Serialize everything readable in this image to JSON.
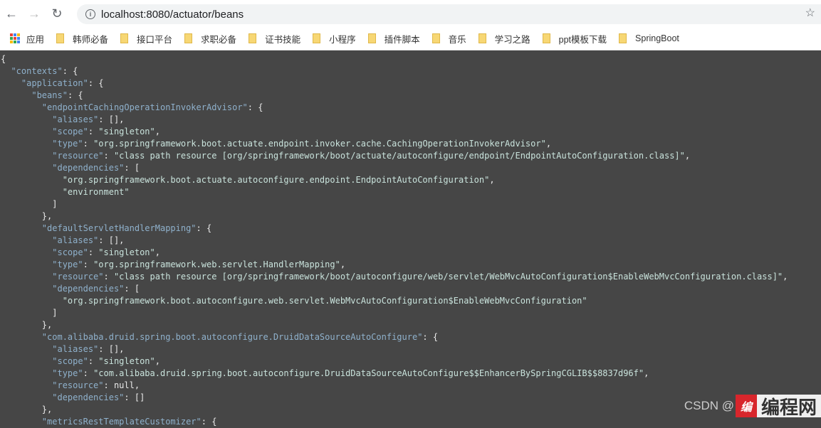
{
  "browser": {
    "url": "localhost:8080/actuator/beans"
  },
  "bookmarks": {
    "apps_label": "应用",
    "items": [
      "韩师必备",
      "接口平台",
      "求职必备",
      "证书技能",
      "小程序",
      "插件脚本",
      "音乐",
      "学习之路",
      "ppt模板下载",
      "SpringBoot"
    ]
  },
  "json_lines": [
    [
      [
        "p",
        "{"
      ]
    ],
    [
      [
        "p",
        "  "
      ],
      [
        "k",
        "\"contexts\""
      ],
      [
        "p",
        ": {"
      ]
    ],
    [
      [
        "p",
        "    "
      ],
      [
        "k",
        "\"application\""
      ],
      [
        "p",
        ": {"
      ]
    ],
    [
      [
        "p",
        "      "
      ],
      [
        "k",
        "\"beans\""
      ],
      [
        "p",
        ": {"
      ]
    ],
    [
      [
        "p",
        "        "
      ],
      [
        "k",
        "\"endpointCachingOperationInvokerAdvisor\""
      ],
      [
        "p",
        ": {"
      ]
    ],
    [
      [
        "p",
        "          "
      ],
      [
        "k",
        "\"aliases\""
      ],
      [
        "p",
        ": [],"
      ]
    ],
    [
      [
        "p",
        "          "
      ],
      [
        "k",
        "\"scope\""
      ],
      [
        "p",
        ": "
      ],
      [
        "s",
        "\"singleton\""
      ],
      [
        "p",
        ","
      ]
    ],
    [
      [
        "p",
        "          "
      ],
      [
        "k",
        "\"type\""
      ],
      [
        "p",
        ": "
      ],
      [
        "s",
        "\"org.springframework.boot.actuate.endpoint.invoker.cache.CachingOperationInvokerAdvisor\""
      ],
      [
        "p",
        ","
      ]
    ],
    [
      [
        "p",
        "          "
      ],
      [
        "k",
        "\"resource\""
      ],
      [
        "p",
        ": "
      ],
      [
        "s",
        "\"class path resource [org/springframework/boot/actuate/autoconfigure/endpoint/EndpointAutoConfiguration.class]\""
      ],
      [
        "p",
        ","
      ]
    ],
    [
      [
        "p",
        "          "
      ],
      [
        "k",
        "\"dependencies\""
      ],
      [
        "p",
        ": ["
      ]
    ],
    [
      [
        "p",
        "            "
      ],
      [
        "s",
        "\"org.springframework.boot.actuate.autoconfigure.endpoint.EndpointAutoConfiguration\""
      ],
      [
        "p",
        ","
      ]
    ],
    [
      [
        "p",
        "            "
      ],
      [
        "s",
        "\"environment\""
      ]
    ],
    [
      [
        "p",
        "          ]"
      ]
    ],
    [
      [
        "p",
        "        },"
      ]
    ],
    [
      [
        "p",
        "        "
      ],
      [
        "k",
        "\"defaultServletHandlerMapping\""
      ],
      [
        "p",
        ": {"
      ]
    ],
    [
      [
        "p",
        "          "
      ],
      [
        "k",
        "\"aliases\""
      ],
      [
        "p",
        ": [],"
      ]
    ],
    [
      [
        "p",
        "          "
      ],
      [
        "k",
        "\"scope\""
      ],
      [
        "p",
        ": "
      ],
      [
        "s",
        "\"singleton\""
      ],
      [
        "p",
        ","
      ]
    ],
    [
      [
        "p",
        "          "
      ],
      [
        "k",
        "\"type\""
      ],
      [
        "p",
        ": "
      ],
      [
        "s",
        "\"org.springframework.web.servlet.HandlerMapping\""
      ],
      [
        "p",
        ","
      ]
    ],
    [
      [
        "p",
        "          "
      ],
      [
        "k",
        "\"resource\""
      ],
      [
        "p",
        ": "
      ],
      [
        "s",
        "\"class path resource [org/springframework/boot/autoconfigure/web/servlet/WebMvcAutoConfiguration$EnableWebMvcConfiguration.class]\""
      ],
      [
        "p",
        ","
      ]
    ],
    [
      [
        "p",
        "          "
      ],
      [
        "k",
        "\"dependencies\""
      ],
      [
        "p",
        ": ["
      ]
    ],
    [
      [
        "p",
        "            "
      ],
      [
        "s",
        "\"org.springframework.boot.autoconfigure.web.servlet.WebMvcAutoConfiguration$EnableWebMvcConfiguration\""
      ]
    ],
    [
      [
        "p",
        "          ]"
      ]
    ],
    [
      [
        "p",
        "        },"
      ]
    ],
    [
      [
        "p",
        "        "
      ],
      [
        "k",
        "\"com.alibaba.druid.spring.boot.autoconfigure.DruidDataSourceAutoConfigure\""
      ],
      [
        "p",
        ": {"
      ]
    ],
    [
      [
        "p",
        "          "
      ],
      [
        "k",
        "\"aliases\""
      ],
      [
        "p",
        ": [],"
      ]
    ],
    [
      [
        "p",
        "          "
      ],
      [
        "k",
        "\"scope\""
      ],
      [
        "p",
        ": "
      ],
      [
        "s",
        "\"singleton\""
      ],
      [
        "p",
        ","
      ]
    ],
    [
      [
        "p",
        "          "
      ],
      [
        "k",
        "\"type\""
      ],
      [
        "p",
        ": "
      ],
      [
        "s",
        "\"com.alibaba.druid.spring.boot.autoconfigure.DruidDataSourceAutoConfigure$$EnhancerBySpringCGLIB$$8837d96f\""
      ],
      [
        "p",
        ","
      ]
    ],
    [
      [
        "p",
        "          "
      ],
      [
        "k",
        "\"resource\""
      ],
      [
        "p",
        ": null,"
      ]
    ],
    [
      [
        "p",
        "          "
      ],
      [
        "k",
        "\"dependencies\""
      ],
      [
        "p",
        ": []"
      ]
    ],
    [
      [
        "p",
        "        },"
      ]
    ],
    [
      [
        "p",
        "        "
      ],
      [
        "k",
        "\"metricsRestTemplateCustomizer\""
      ],
      [
        "p",
        ": {"
      ]
    ]
  ],
  "watermark": {
    "csdn": "CSDN @",
    "logo": "编程网"
  },
  "colors": {
    "background": "#464646",
    "key": "#8fb1cc",
    "string": "#c9e3dc"
  }
}
